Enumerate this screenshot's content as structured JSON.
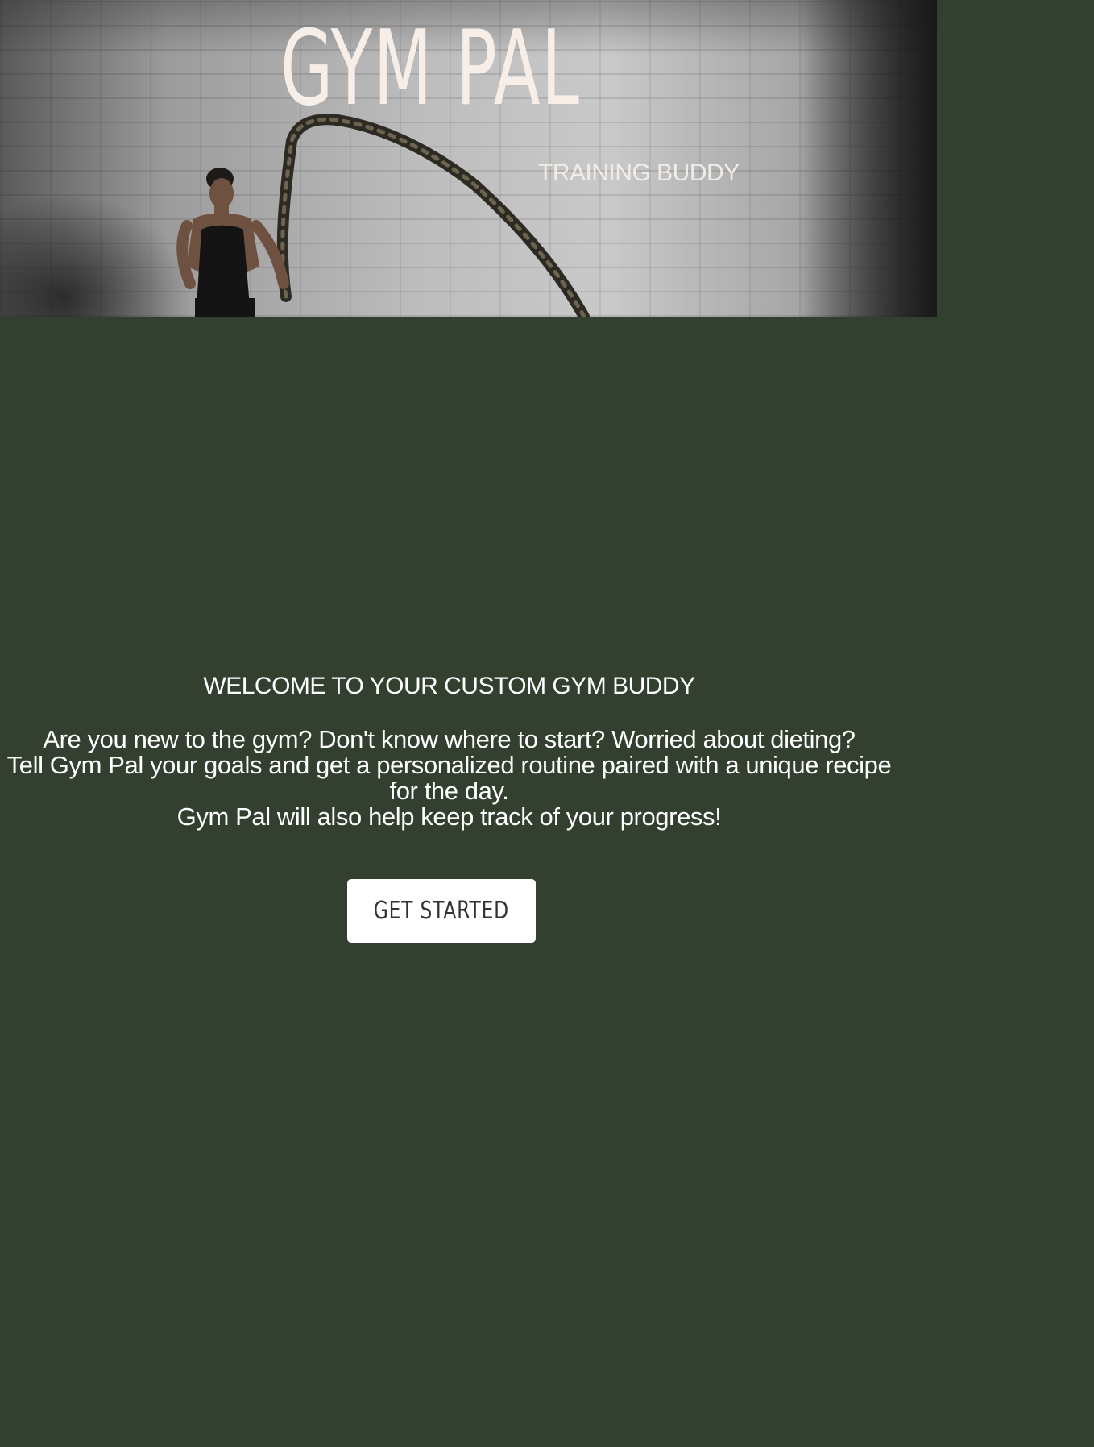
{
  "hero": {
    "title": "GYM PAL",
    "subtitle": "TRAINING BUDDY",
    "image": "woman-with-battle-rope"
  },
  "intro": {
    "heading": "WELCOME TO YOUR CUSTOM GYM BUDDY",
    "lines": [
      "Are you new to the gym? Don't know where to start? Worried about dieting?",
      "Tell Gym Pal your goals and get a personalized routine paired with a unique recipe for the day.",
      "Gym Pal will also help keep track of your progress!"
    ]
  },
  "cta": {
    "label": "GET STARTED"
  },
  "colors": {
    "background": "#334030",
    "title": "#f7eee8",
    "button_bg": "#ffffff",
    "button_text": "#333333"
  }
}
